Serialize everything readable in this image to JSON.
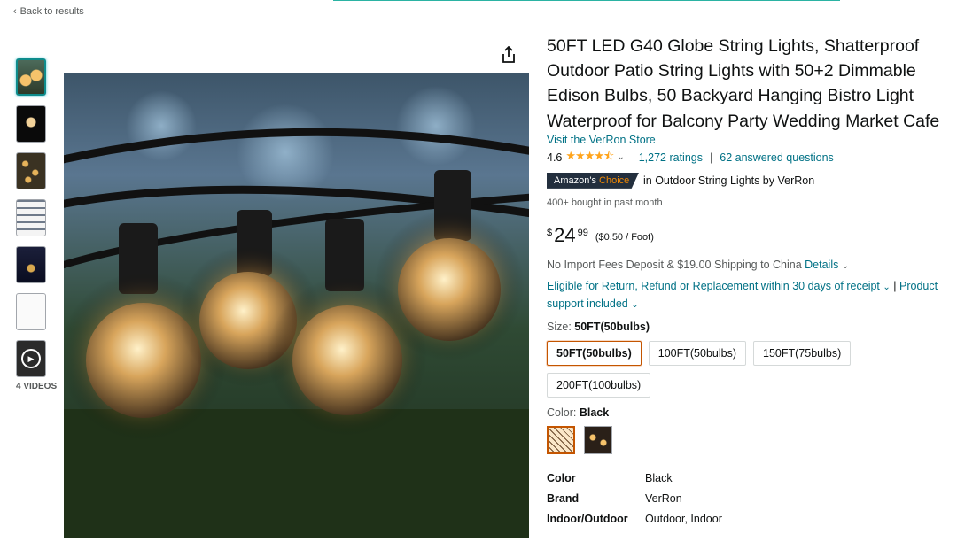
{
  "nav": {
    "back_label": "Back to results"
  },
  "thumbnails": {
    "videos_label": "4 VIDEOS"
  },
  "product": {
    "title": "50FT LED G40 Globe String Lights, Shatterproof Outdoor Patio String Lights with 50+2 Dimmable Edison Bulbs, 50 Backyard Hanging Bistro Light Waterproof for Balcony Party Wedding Market Cafe",
    "store_link": "Visit the VerRon Store",
    "rating_value": "4.6",
    "ratings_count": "1,272 ratings",
    "separator": "|",
    "answered": "62 answered questions",
    "badge_part1": "Amazon's",
    "badge_part2": "Choice",
    "badge_context": "in Outdoor String Lights by VerRon",
    "bought": "400+ bought in past month",
    "price_symbol": "$",
    "price_whole": "24",
    "price_fraction": "99",
    "price_unit": "($0.50 / Foot)",
    "shipping_text": "No Import Fees Deposit & $19.00 Shipping to China",
    "shipping_details": "Details",
    "eligibility": "Eligible for Return, Refund or Replacement within 30 days of receipt",
    "support_sep": "|",
    "support": "Product support included"
  },
  "size": {
    "label": "Size:",
    "selected": "50FT(50bulbs)",
    "options": [
      "50FT(50bulbs)",
      "100FT(50bulbs)",
      "150FT(75bulbs)",
      "200FT(100bulbs)"
    ]
  },
  "color": {
    "label": "Color:",
    "selected": "Black"
  },
  "specs": [
    {
      "key": "Color",
      "value": "Black"
    },
    {
      "key": "Brand",
      "value": "VerRon"
    },
    {
      "key": "Indoor/Outdoor",
      "value": "Outdoor, Indoor"
    }
  ],
  "colors": {
    "link": "#007185",
    "rating_star": "#ffa41c",
    "selected_border": "#c45500",
    "badge_bg": "#232f3e"
  }
}
